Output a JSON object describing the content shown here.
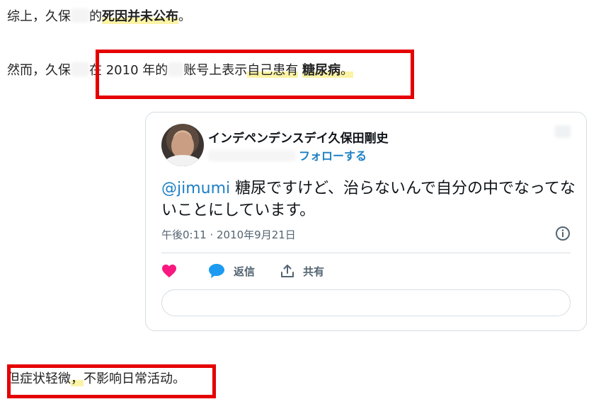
{
  "article": {
    "p1": {
      "before": "综上，久保",
      "after": "的",
      "highlight": "死因并未公布",
      "end": "。"
    },
    "p2": {
      "before": "然而，久保",
      "mid1": "在 2010 年的",
      "mid2": "账号上表示",
      "highlight_plain": "自己患有",
      "highlight_bold": "糖尿病",
      "end": "。"
    },
    "p3": {
      "start": "但症状轻微",
      "comma": "，",
      "rest": "不影响日常活动。"
    }
  },
  "tweet": {
    "author_name": "インデペンデンスデイ久保田剛史",
    "follow_label": "フォローする",
    "mention": "@jimumi",
    "text": " 糖尿ですけど、治らないんで自分の中でなってないことにしています。",
    "timestamp": "午後0:11 · 2010年9月21日",
    "reply_label": "返信",
    "share_label": "共有"
  },
  "colors": {
    "annotation_box": "#e50000",
    "highlight": "#fbf3a6",
    "link": "#1d7fc4",
    "like": "#f91880"
  },
  "icons": [
    "heart-icon",
    "reply-icon",
    "share-icon",
    "info-icon"
  ]
}
